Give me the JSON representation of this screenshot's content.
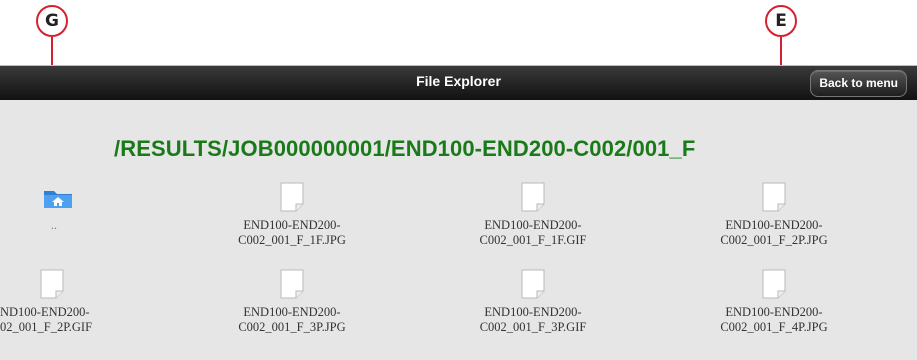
{
  "callouts": {
    "g_label": "G",
    "e_label": "E"
  },
  "titlebar": {
    "title": "File Explorer",
    "back_label": "Back to menu"
  },
  "path": "/RESULTS/JOB000000001/END100-END200-C002/001_F",
  "parent_dir": {
    "icon": "home-folder-icon",
    "label": ".."
  },
  "files": [
    {
      "line1": "END100-END200-",
      "line2": "C002_001_F_1F.JPG",
      "icon": "file-icon"
    },
    {
      "line1": "END100-END200-",
      "line2": "C002_001_F_1F.GIF",
      "icon": "file-icon"
    },
    {
      "line1": "END100-END200-",
      "line2": "C002_001_F_2P.JPG",
      "icon": "file-icon"
    },
    {
      "line1": "ND100-END200-",
      "line2": "02_001_F_2P.GIF",
      "icon": "file-icon"
    },
    {
      "line1": "END100-END200-",
      "line2": "C002_001_F_3P.JPG",
      "icon": "file-icon"
    },
    {
      "line1": "END100-END200-",
      "line2": "C002_001_F_3P.GIF",
      "icon": "file-icon"
    },
    {
      "line1": "END100-END200-",
      "line2": "C002_001_F_4P.JPG",
      "icon": "file-icon"
    }
  ],
  "colors": {
    "callout": "#d6202e",
    "path": "#1a7a1a",
    "titlebar": "#1a1a1a",
    "background": "#e6e6e6"
  }
}
